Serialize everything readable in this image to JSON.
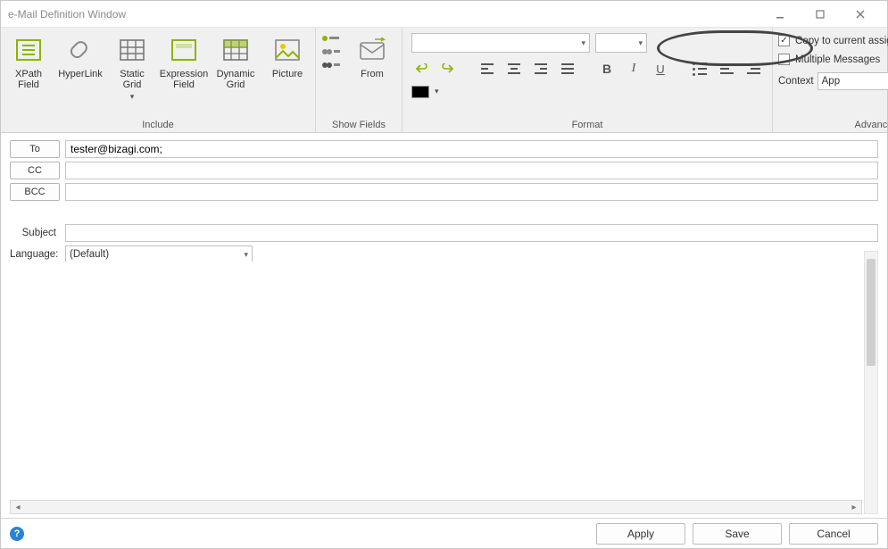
{
  "window": {
    "title": "e-Mail Definition Window"
  },
  "ribbon": {
    "include": {
      "label": "Include",
      "xpath": "XPath\nField",
      "hyperlink": "HyperLink",
      "staticgrid": "Static\nGrid",
      "exprfield": "Expression\nField",
      "dyngrid": "Dynamic\nGrid",
      "picture": "Picture"
    },
    "showfields": {
      "label": "Show Fields",
      "from": "From"
    },
    "format": {
      "label": "Format"
    },
    "advanced": {
      "label": "Advanced",
      "copy": "Copy to current assignee",
      "multiple": "Multiple Messages",
      "context_label": "Context",
      "context_value": "App"
    }
  },
  "fields": {
    "to_label": "To",
    "to_value": "tester@bizagi.com;",
    "cc_label": "CC",
    "cc_value": "",
    "bcc_label": "BCC",
    "bcc_value": "",
    "subject_label": "Subject",
    "subject_value": "",
    "language_label": "Language:",
    "language_value": "(Default)"
  },
  "footer": {
    "apply": "Apply",
    "save": "Save",
    "cancel": "Cancel"
  }
}
